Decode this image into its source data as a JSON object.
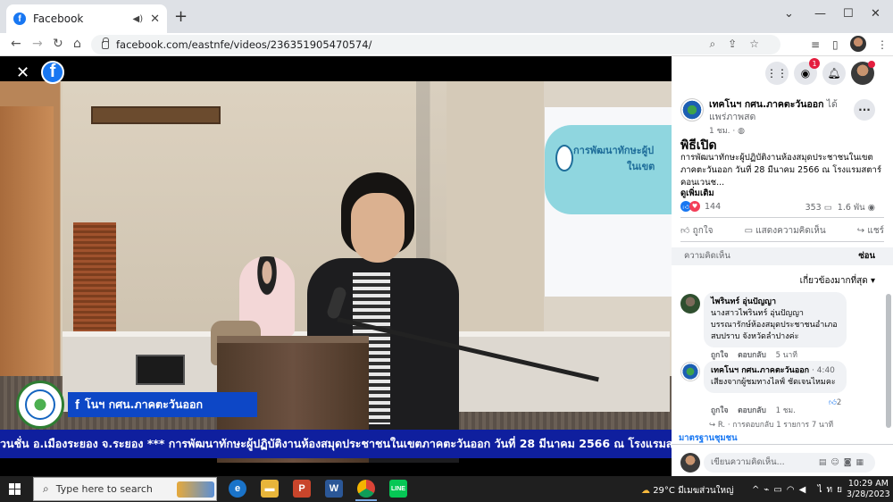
{
  "browser": {
    "tab_title": "Facebook",
    "url": "facebook.com/eastnfe/videos/236351905470574/",
    "new_tab": "+",
    "win_min": "⌄",
    "win_minimize": "—",
    "win_max": "☐",
    "win_close": "✕"
  },
  "video": {
    "projection_text_line1": "การพัฒนาทักษะผู้ป",
    "projection_text_line2": "ในเขต",
    "lower_third_name": "โนฯ กศน.ภาคตะวันออก",
    "ticker": "วนชั่น อ.เมืองระยอง จ.ระยอง      *** การพัฒนาทักษะผู้ปฏิบัติงานห้องสมุดประชาชนในเขตภาคตะวันออก วันที่ 28 มีนาคม 2566 ณ โรงแรมสตา"
  },
  "panel": {
    "notif_count": "1",
    "page_name": "เทคโนฯ กศน.ภาคตะวันออก",
    "page_action": "ได้แพร่ภาพสด",
    "post_time": "1 ชม. ·",
    "post_heading": "พิธีเปิด",
    "post_body": "การพัฒนาทักษะผู้ปฏิบัติงานห้องสมุดประชาชนในเขตภาคตะวันออก วันที่ 28 มีนาคม 2566 ณ โรงแรมสตาร์ คอนเวนช...",
    "see_more": "ดูเพิ่มเติม",
    "reaction_count": "144",
    "comment_count": "353",
    "view_count": "1.6 พัน",
    "like_label": "ถูกใจ",
    "comment_label": "แสดงความคิดเห็น",
    "share_label": "แชร์",
    "comments_header": "ความคิดเห็น",
    "hide_label": "ซ่อน",
    "sort_label": "เกี่ยวข้องมากที่สุด",
    "comments": [
      {
        "author": "ไพรินทร์ อุ่นปัญญา",
        "text": "นางสาวไพรินทร์ อุ่นปัญญา บรรณารักษ์ห้องสมุดประชาชนอำเภอสบปราบ จังหวัดลำปางค่ะ",
        "like": "ถูกใจ",
        "reply": "ตอบกลับ",
        "time": "5 นาที"
      },
      {
        "author": "เทคโนฯ กศน.ภาคตะวันออก",
        "author_time": "· 4:40",
        "text": "เสียงจากผู้ชมทางไลฟ์ ชัดเจนไหมคะ",
        "like": "ถูกใจ",
        "reply": "ตอบกลับ",
        "time": "1 ชม.",
        "react_count": "2"
      }
    ],
    "reply_line": "R. · การตอบกลับ 1 รายการ",
    "reply_time": "7 นาที",
    "standards": "มาตรฐานชุมชน",
    "write_placeholder": "เขียนความคิดเห็น..."
  },
  "taskbar": {
    "search_placeholder": "Type here to search",
    "temperature": "29°C",
    "weather_desc": "มีเมฆส่วนใหญ่",
    "lang": "ไทย",
    "time": "10:29 AM",
    "date": "3/28/2023"
  }
}
